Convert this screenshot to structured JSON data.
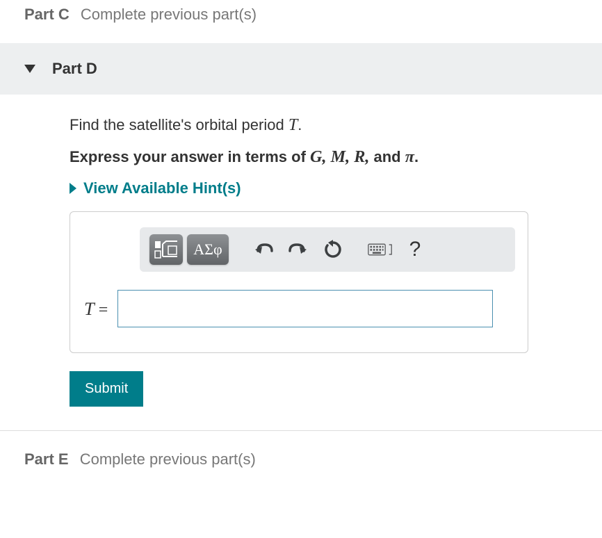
{
  "partC": {
    "label": "Part C",
    "status": "Complete previous part(s)"
  },
  "partD": {
    "title": "Part D",
    "prompt_prefix": "Find the satellite's orbital period ",
    "prompt_var": "T",
    "prompt_suffix": ".",
    "instruction_prefix": "Express your answer in terms of ",
    "instruction_vars": "G, M, R,",
    "instruction_and": " and ",
    "instruction_pi": "π",
    "instruction_suffix": ".",
    "hints_label": "View Available Hint(s)",
    "toolbar": {
      "greek_label": "ΑΣφ",
      "help_label": "?"
    },
    "equation_lhs_var": "T",
    "equation_lhs_eq": " =",
    "answer_value": "",
    "submit_label": "Submit"
  },
  "partE": {
    "label": "Part E",
    "status": "Complete previous part(s)"
  }
}
